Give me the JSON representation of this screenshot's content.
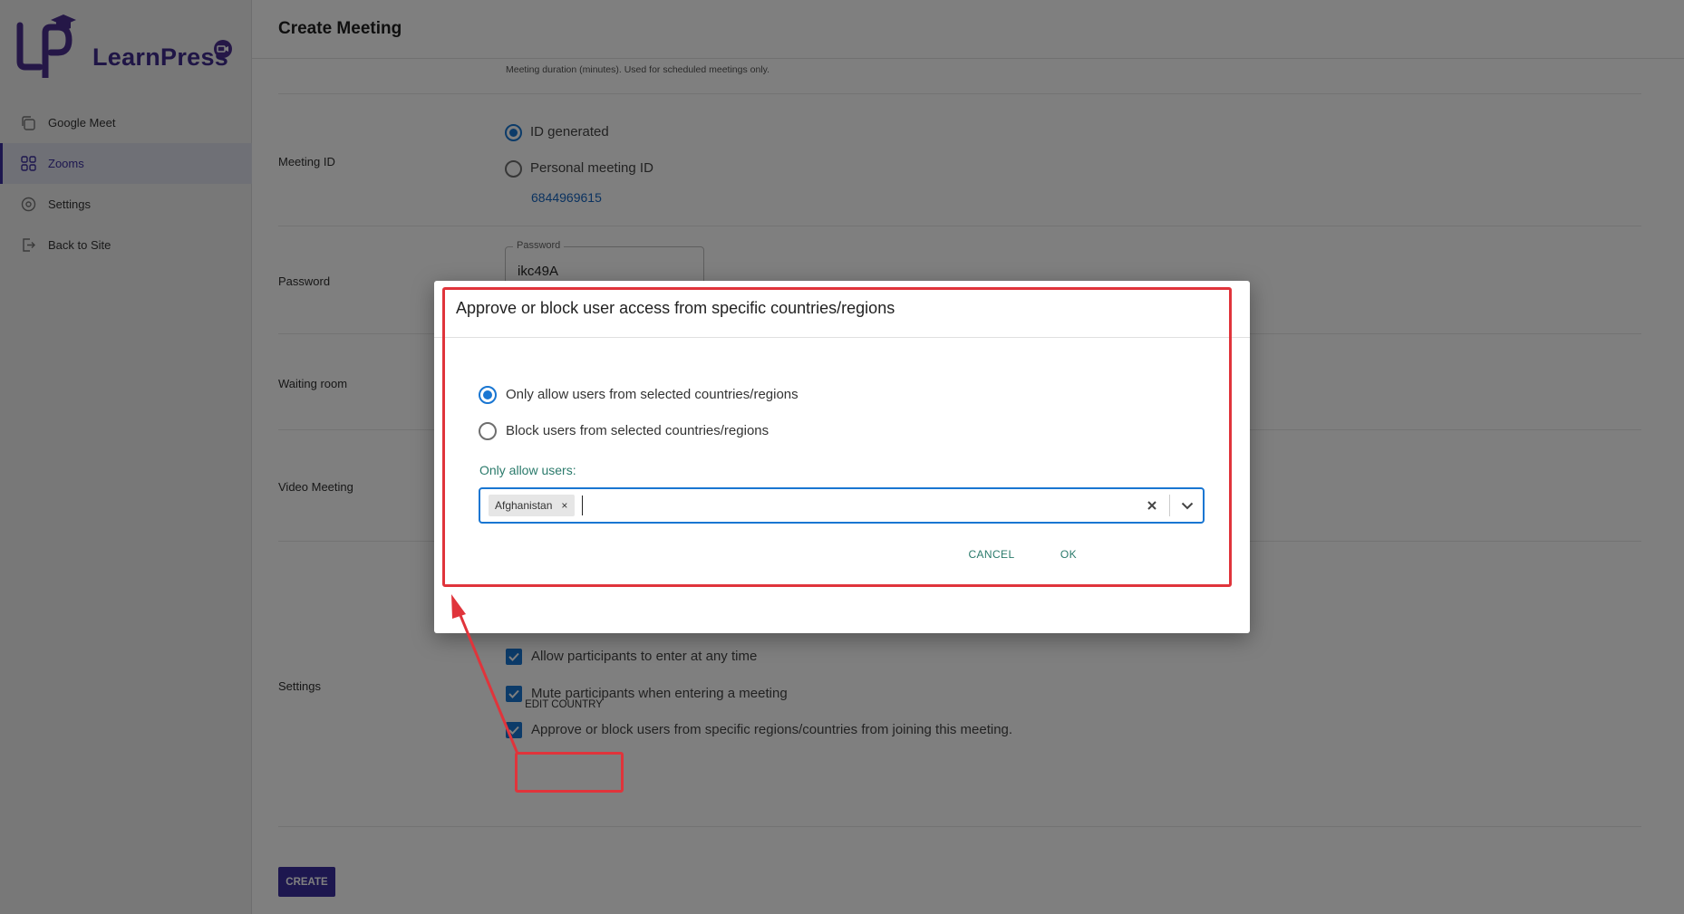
{
  "app": {
    "logo_text": "LearnPress",
    "page_title": "Create Meeting"
  },
  "sidebar": {
    "items": [
      {
        "label": "Google Meet",
        "icon": "copy-icon",
        "active": false
      },
      {
        "label": "Zooms",
        "icon": "grid-icon",
        "active": true
      },
      {
        "label": "Settings",
        "icon": "gear-icon",
        "active": false
      },
      {
        "label": "Back to Site",
        "icon": "exit-icon",
        "active": false
      }
    ]
  },
  "form": {
    "duration_hint": "Meeting duration (minutes). Used for scheduled meetings only.",
    "meeting_id": {
      "label": "Meeting ID",
      "option_generated": "ID generated",
      "option_personal": "Personal meeting ID",
      "personal_id": "6844969615",
      "selected": "ID generated"
    },
    "password": {
      "label": "Password",
      "legend": "Password",
      "value": "ikc49A"
    },
    "waiting_room": {
      "label": "Waiting room"
    },
    "video_meeting": {
      "label": "Video Meeting"
    },
    "settings": {
      "label": "Settings",
      "options": [
        {
          "label": "Allow participants to enter at any time",
          "checked": true
        },
        {
          "label": "Mute participants when entering a meeting",
          "checked": true
        },
        {
          "label": "Approve or block users from specific regions/countries from joining this meeting.",
          "checked": true
        }
      ],
      "edit_country_label": "EDIT COUNTRY"
    },
    "create_label": "CREATE"
  },
  "modal": {
    "title": "Approve or block user access from specific countries/regions",
    "option_allow": "Only allow users from selected countries/regions",
    "option_block": "Block users from selected countries/regions",
    "selected": "Only allow users from selected countries/regions",
    "field_label": "Only allow users:",
    "selected_countries": [
      "Afghanistan"
    ],
    "cancel_label": "CANCEL",
    "ok_label": "OK"
  },
  "colors": {
    "brand": "#3b2f9e",
    "accent": "#1976d2",
    "dialog_action": "#2a7a6b",
    "annotation": "#e0343b"
  }
}
